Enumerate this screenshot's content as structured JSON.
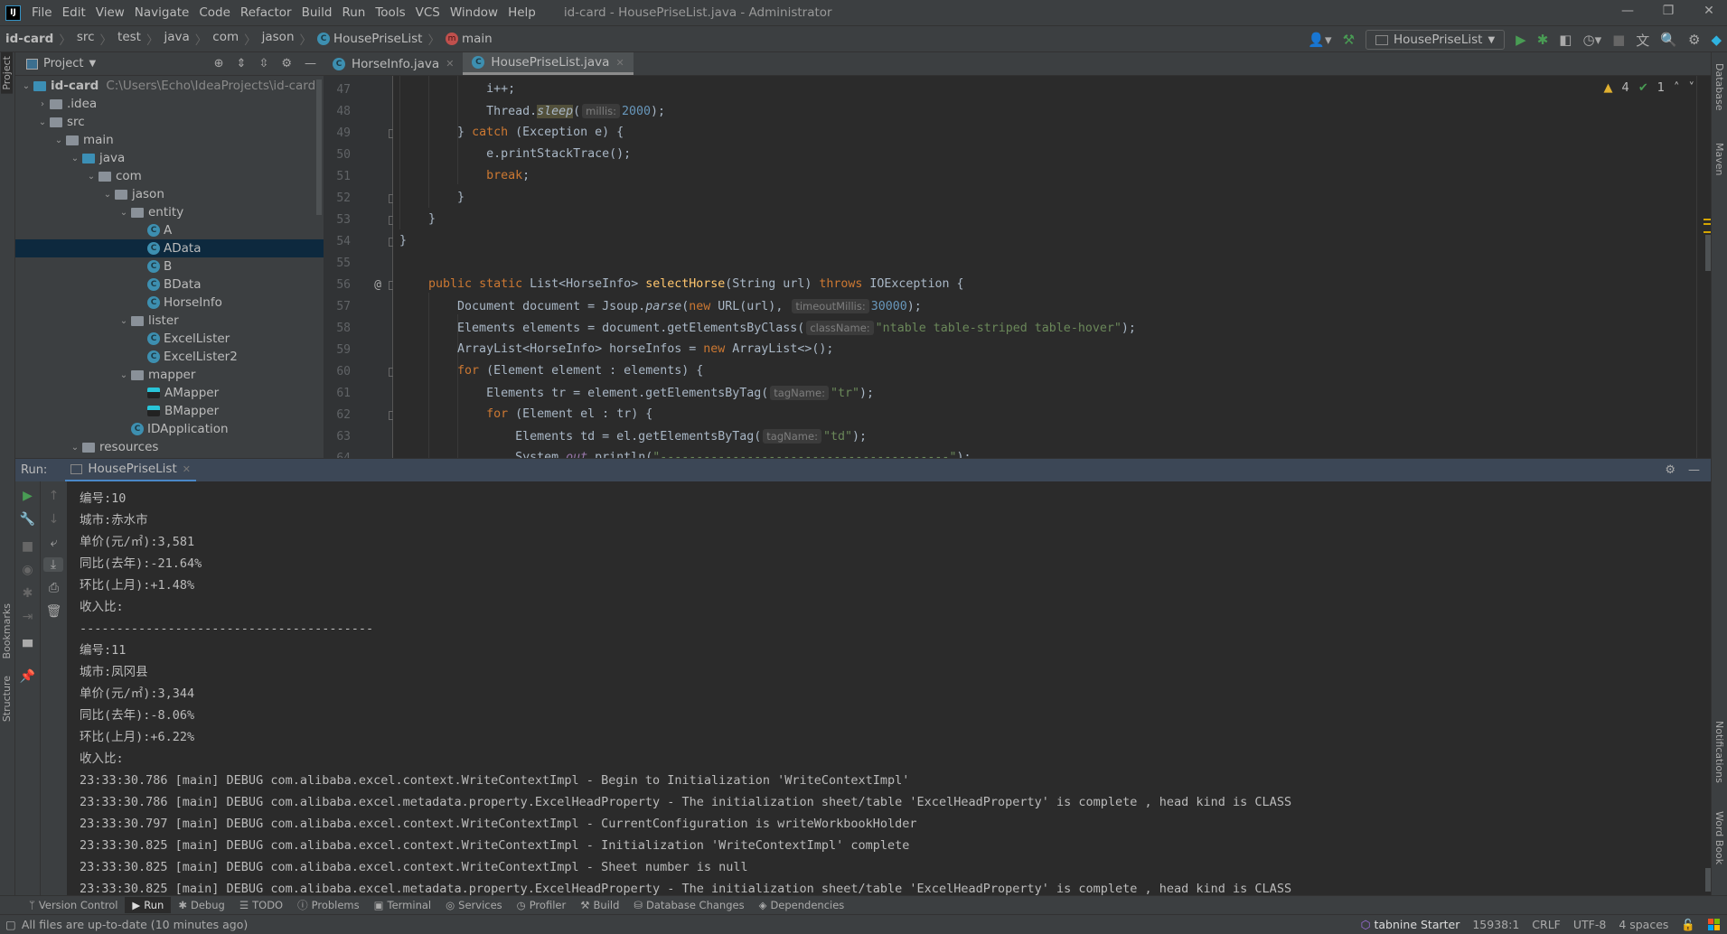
{
  "menubar": {
    "items": [
      "File",
      "Edit",
      "View",
      "Navigate",
      "Code",
      "Refactor",
      "Build",
      "Run",
      "Tools",
      "VCS",
      "Window",
      "Help"
    ],
    "window_title": "id-card - HousePriseList.java - Administrator"
  },
  "breadcrumb": {
    "project": "id-card",
    "parts": [
      "src",
      "test",
      "java",
      "com",
      "jason"
    ],
    "class": "HousePriseList",
    "method": "main"
  },
  "toolbar": {
    "run_config": "HousePriseList"
  },
  "sidestrips": {
    "left": [
      "Project",
      "Bookmarks",
      "Structure"
    ],
    "right": [
      "Database",
      "Maven",
      "Notifications",
      "Word Book"
    ]
  },
  "project_panel": {
    "title": "Project",
    "tree": [
      {
        "label": "id-card",
        "path": "C:\\Users\\Echo\\IdeaProjects\\id-card",
        "depth": 0,
        "arrow": "down",
        "icon": "module-folder",
        "bold": true
      },
      {
        "label": ".idea",
        "depth": 1,
        "arrow": "right",
        "icon": "folder"
      },
      {
        "label": "src",
        "depth": 1,
        "arrow": "down",
        "icon": "folder"
      },
      {
        "label": "main",
        "depth": 2,
        "arrow": "down",
        "icon": "folder"
      },
      {
        "label": "java",
        "depth": 3,
        "arrow": "down",
        "icon": "source-folder"
      },
      {
        "label": "com",
        "depth": 4,
        "arrow": "down",
        "icon": "package"
      },
      {
        "label": "jason",
        "depth": 5,
        "arrow": "down",
        "icon": "package"
      },
      {
        "label": "entity",
        "depth": 6,
        "arrow": "down",
        "icon": "package"
      },
      {
        "label": "A",
        "depth": 7,
        "icon": "class"
      },
      {
        "label": "AData",
        "depth": 7,
        "icon": "class",
        "selected": true
      },
      {
        "label": "B",
        "depth": 7,
        "icon": "class"
      },
      {
        "label": "BData",
        "depth": 7,
        "icon": "class"
      },
      {
        "label": "HorseInfo",
        "depth": 7,
        "icon": "class"
      },
      {
        "label": "lister",
        "depth": 6,
        "arrow": "down",
        "icon": "package"
      },
      {
        "label": "ExcelLister",
        "depth": 7,
        "icon": "class"
      },
      {
        "label": "ExcelLister2",
        "depth": 7,
        "icon": "class"
      },
      {
        "label": "mapper",
        "depth": 6,
        "arrow": "down",
        "icon": "package"
      },
      {
        "label": "AMapper",
        "depth": 7,
        "icon": "mapper"
      },
      {
        "label": "BMapper",
        "depth": 7,
        "icon": "mapper"
      },
      {
        "label": "IDApplication",
        "depth": 6,
        "icon": "spring-class"
      },
      {
        "label": "resources",
        "depth": 3,
        "arrow": "down",
        "icon": "resources-folder"
      }
    ]
  },
  "editor": {
    "tabs": [
      {
        "label": "HorseInfo.java",
        "active": false
      },
      {
        "label": "HousePriseList.java",
        "active": true
      }
    ],
    "inspections": {
      "warnings": "4",
      "weak_warnings": "1"
    },
    "lines": [
      {
        "n": "47",
        "t": [
          [
            "            i++;",
            ""
          ]
        ]
      },
      {
        "n": "48",
        "t": [
          [
            "            Thread.",
            ""
          ],
          [
            "sleep",
            "it hl"
          ],
          [
            "(",
            ""
          ],
          [
            "millis:",
            "hint"
          ],
          [
            "2000",
            "num"
          ],
          [
            ");",
            ""
          ]
        ]
      },
      {
        "n": "49",
        "fold": true,
        "t": [
          [
            "        } ",
            ""
          ],
          [
            "catch",
            "kw"
          ],
          [
            " (Exception e) {",
            ""
          ]
        ]
      },
      {
        "n": "50",
        "t": [
          [
            "            e.printStackTrace();",
            ""
          ]
        ]
      },
      {
        "n": "51",
        "t": [
          [
            "            ",
            ""
          ],
          [
            "break",
            "kw"
          ],
          [
            ";",
            ""
          ]
        ]
      },
      {
        "n": "52",
        "fold": true,
        "t": [
          [
            "        }",
            ""
          ]
        ]
      },
      {
        "n": "53",
        "fold": true,
        "t": [
          [
            "    }",
            ""
          ]
        ]
      },
      {
        "n": "54",
        "fold": true,
        "t": [
          [
            "}",
            ""
          ]
        ]
      },
      {
        "n": "55",
        "t": [
          [
            "",
            ""
          ]
        ]
      },
      {
        "n": "56",
        "fold": true,
        "marker": "@",
        "t": [
          [
            "    ",
            ""
          ],
          [
            "public static",
            "kw"
          ],
          [
            " List<HorseInfo> ",
            ""
          ],
          [
            "selectHorse",
            "fn"
          ],
          [
            "(String url) ",
            ""
          ],
          [
            "throws",
            "kw"
          ],
          [
            " IOException {",
            ""
          ]
        ]
      },
      {
        "n": "57",
        "t": [
          [
            "        Document document = Jsoup.",
            ""
          ],
          [
            "parse",
            "it"
          ],
          [
            "(",
            ""
          ],
          [
            "new",
            "kw"
          ],
          [
            " URL(url), ",
            ""
          ],
          [
            "timeoutMillis:",
            "hint"
          ],
          [
            "30000",
            "num"
          ],
          [
            ");",
            ""
          ]
        ]
      },
      {
        "n": "58",
        "t": [
          [
            "        Elements elements = document.getElementsByClass(",
            ""
          ],
          [
            "className:",
            "hint"
          ],
          [
            "\"ntable table-striped table-hover\"",
            "str"
          ],
          [
            ");",
            ""
          ]
        ]
      },
      {
        "n": "59",
        "t": [
          [
            "        ArrayList<HorseInfo> horseInfos = ",
            ""
          ],
          [
            "new",
            "kw"
          ],
          [
            " ArrayList<>();",
            ""
          ]
        ]
      },
      {
        "n": "60",
        "fold": true,
        "t": [
          [
            "        ",
            ""
          ],
          [
            "for",
            "kw"
          ],
          [
            " (Element element : elements) {",
            ""
          ]
        ]
      },
      {
        "n": "61",
        "t": [
          [
            "            Elements tr = element.getElementsByTag(",
            ""
          ],
          [
            "tagName:",
            "hint"
          ],
          [
            "\"tr\"",
            "str"
          ],
          [
            ");",
            ""
          ]
        ]
      },
      {
        "n": "62",
        "fold": true,
        "t": [
          [
            "            ",
            ""
          ],
          [
            "for",
            "kw"
          ],
          [
            " (Element el : tr) {",
            ""
          ]
        ]
      },
      {
        "n": "63",
        "t": [
          [
            "                Elements td = el.getElementsByTag(",
            ""
          ],
          [
            "tagName:",
            "hint"
          ],
          [
            "\"td\"",
            "str"
          ],
          [
            ");",
            ""
          ]
        ]
      },
      {
        "n": "64",
        "t": [
          [
            "                System.",
            ""
          ],
          [
            "out",
            "fld"
          ],
          [
            ".println(",
            ""
          ],
          [
            "\"----------------------------------------\"",
            "str"
          ],
          [
            ");",
            ""
          ]
        ]
      }
    ]
  },
  "run_panel": {
    "label": "Run:",
    "tab": "HousePriseList",
    "output": [
      "编号:10",
      "城市:赤水市",
      "单价(元/㎡):3,581",
      "同比(去年):-21.64%",
      "环比(上月):+1.48%",
      "收入比:",
      "----------------------------------------",
      "编号:11",
      "城市:凤冈县",
      "单价(元/㎡):3,344",
      "同比(去年):-8.06%",
      "环比(上月):+6.22%",
      "收入比:",
      "23:33:30.786 [main] DEBUG com.alibaba.excel.context.WriteContextImpl - Begin to Initialization 'WriteContextImpl'",
      "23:33:30.786 [main] DEBUG com.alibaba.excel.metadata.property.ExcelHeadProperty - The initialization sheet/table 'ExcelHeadProperty' is complete , head kind is CLASS",
      "23:33:30.797 [main] DEBUG com.alibaba.excel.context.WriteContextImpl - CurrentConfiguration is writeWorkbookHolder",
      "23:33:30.825 [main] DEBUG com.alibaba.excel.context.WriteContextImpl - Initialization 'WriteContextImpl' complete",
      "23:33:30.825 [main] DEBUG com.alibaba.excel.context.WriteContextImpl - Sheet number is null",
      "23:33:30.825 [main] DEBUG com.alibaba.excel.metadata.property.ExcelHeadProperty - The initialization sheet/table 'ExcelHeadProperty' is complete , head kind is CLASS"
    ]
  },
  "bottom_tools": [
    {
      "label": "Version Control",
      "icon": "branch-icon"
    },
    {
      "label": "Run",
      "icon": "play-icon",
      "active": true
    },
    {
      "label": "Debug",
      "icon": "bug-icon"
    },
    {
      "label": "TODO",
      "icon": "list-icon"
    },
    {
      "label": "Problems",
      "icon": "warning-icon"
    },
    {
      "label": "Terminal",
      "icon": "terminal-icon"
    },
    {
      "label": "Services",
      "icon": "services-icon"
    },
    {
      "label": "Profiler",
      "icon": "profiler-icon"
    },
    {
      "label": "Build",
      "icon": "hammer-icon"
    },
    {
      "label": "Database Changes",
      "icon": "database-icon"
    },
    {
      "label": "Dependencies",
      "icon": "dependencies-icon"
    }
  ],
  "statusbar": {
    "message": "All files are up-to-date (10 minutes ago)",
    "tabnine": "tabnine Starter",
    "position": "15938:1",
    "line_ending": "CRLF",
    "encoding": "UTF-8",
    "indent": "4 spaces"
  },
  "colors": {
    "keyword": "#cc7832",
    "string": "#6a8759",
    "number": "#6897bb",
    "function": "#ffc66d",
    "selection": "#0d293e",
    "run_accent": "#4a88c7",
    "run_green": "#499c54"
  }
}
